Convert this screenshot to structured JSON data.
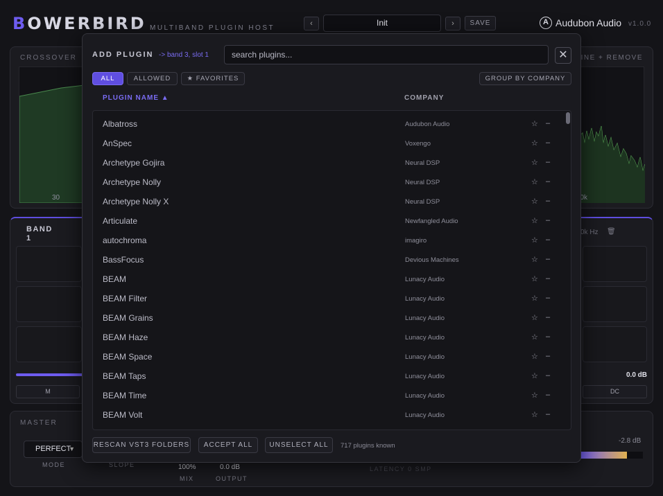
{
  "header": {
    "brand_first": "B",
    "brand_rest": "OWERBIRD",
    "subtitle": "MULTIBAND PLUGIN HOST",
    "prev": "‹",
    "next": "›",
    "preset": "Init",
    "save": "SAVE",
    "logo_letter": "A",
    "company": "Audubon Audio",
    "version": "v1.0.0"
  },
  "crossover": {
    "label": "CROSSOVER",
    "right_label": "X LINE + REMOVE",
    "tick_low": "30",
    "tick_high": "0k"
  },
  "bands": {
    "label": "BAND 1",
    "hz": "0k Hz",
    "trash": "🗑",
    "out_db": "0.0 dB",
    "btn_m": "M",
    "btn_dc": "DC"
  },
  "master": {
    "label": "MASTER",
    "mode_value": "PERFECT",
    "mode_label": "MODE",
    "slope_label": "SLOPE",
    "mix_value": "100%",
    "mix_label": "MIX",
    "output_value": "0.0 dB",
    "output_label": "OUTPUT",
    "latency": "LATENCY 0 SMP",
    "meter_db": "-2.8 dB",
    "meter_level": 0.74
  },
  "modal": {
    "title": "ADD PLUGIN",
    "target": "-> band 3, slot 1",
    "search_placeholder": "search plugins...",
    "close": "✕",
    "filters": {
      "all": "ALL",
      "allowed": "ALLOWED",
      "favorites": "★ FAVORITES"
    },
    "group_by": "GROUP BY COMPANY",
    "col_name": "PLUGIN NAME ▲",
    "col_company": "COMPANY",
    "plugins": [
      {
        "name": "Albatross",
        "company": "Audubon Audio"
      },
      {
        "name": "AnSpec",
        "company": "Voxengo"
      },
      {
        "name": "Archetype Gojira",
        "company": "Neural DSP"
      },
      {
        "name": "Archetype Nolly",
        "company": "Neural DSP"
      },
      {
        "name": "Archetype Nolly X",
        "company": "Neural DSP"
      },
      {
        "name": "Articulate",
        "company": "Newfangled Audio"
      },
      {
        "name": "autochroma",
        "company": "imagiro"
      },
      {
        "name": "BassFocus",
        "company": "Devious Machines"
      },
      {
        "name": "BEAM",
        "company": "Lunacy Audio"
      },
      {
        "name": "BEAM Filter",
        "company": "Lunacy Audio"
      },
      {
        "name": "BEAM Grains",
        "company": "Lunacy Audio"
      },
      {
        "name": "BEAM Haze",
        "company": "Lunacy Audio"
      },
      {
        "name": "BEAM Space",
        "company": "Lunacy Audio"
      },
      {
        "name": "BEAM Taps",
        "company": "Lunacy Audio"
      },
      {
        "name": "BEAM Time",
        "company": "Lunacy Audio"
      },
      {
        "name": "BEAM Volt",
        "company": "Lunacy Audio"
      }
    ],
    "star": "☆",
    "dash": "–",
    "rescan": "RESCAN VST3 FOLDERS",
    "accept_all": "ACCEPT ALL",
    "unselect_all": "UNSELECT ALL",
    "count": "717 plugins known"
  },
  "colors": {
    "accent": "#6e5cf0",
    "bg": "#141418",
    "meter_hot": "#e0b050"
  }
}
